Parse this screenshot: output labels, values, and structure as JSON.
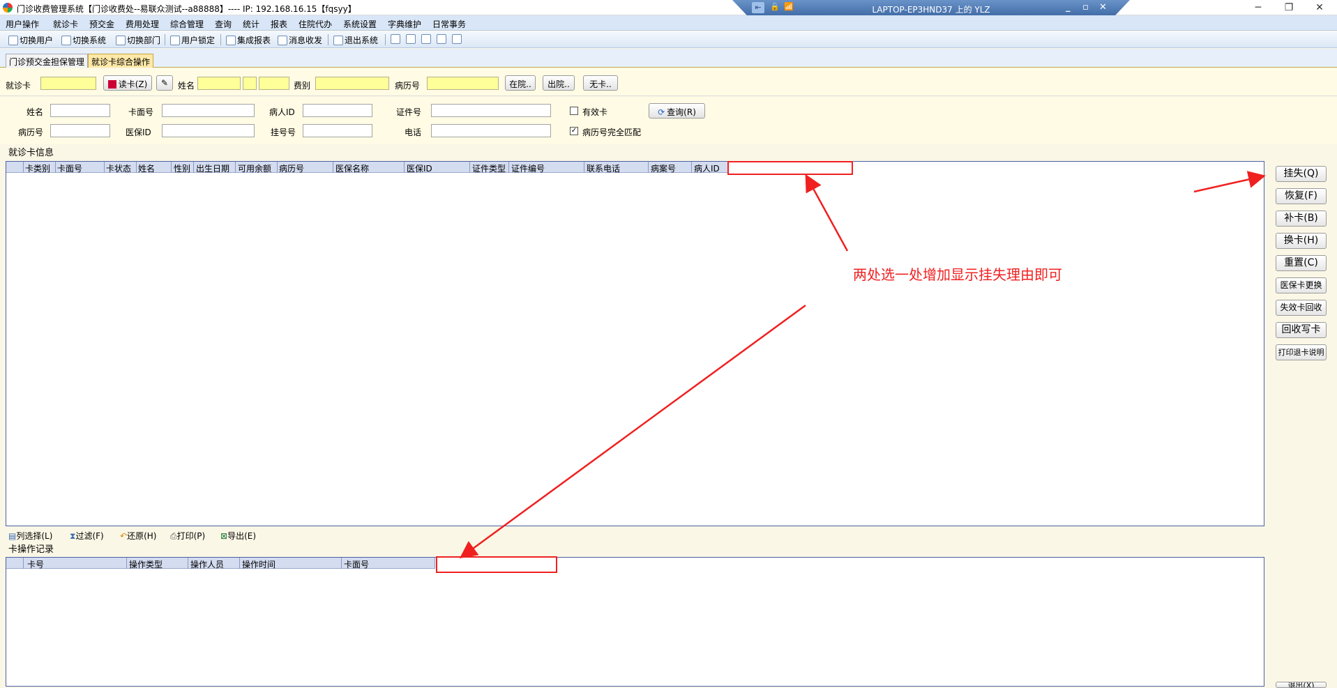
{
  "window": {
    "title": "门诊收费管理系统【门诊收费处--易联众测试--a88888】---- IP:  192.168.16.15【fqsyy】",
    "minimize": "─",
    "maximize": "❐",
    "close": "✕"
  },
  "rdp": {
    "title": "LAPTOP-EP3HND37 上的 YLZ",
    "pin": "⇤",
    "lock": "🔒",
    "signal": "📶",
    "min": "_",
    "restore": "▫",
    "close": "✕"
  },
  "menu": [
    "用户操作",
    "就诊卡",
    "预交金",
    "费用处理",
    "综合管理",
    "查询",
    "统计",
    "报表",
    "住院代办",
    "系统设置",
    "字典维护",
    "日常事务"
  ],
  "toolbar": [
    "切换用户",
    "切换系统",
    "切换部门",
    "用户锁定",
    "集成报表",
    "消息收发",
    "退出系统"
  ],
  "tabs": [
    "门诊预交金担保管理",
    "就诊卡综合操作"
  ],
  "top_form": {
    "card_label": "就诊卡",
    "read_card_btn": "读卡(Z)",
    "name_label": "姓名",
    "fee_type_label": "费别",
    "record_no_label": "病历号",
    "in_hospital_btn": "在院..",
    "discharge_btn": "出院..",
    "no_card_btn": "无卡.."
  },
  "search_form": {
    "name": "姓名",
    "card_face_no": "卡面号",
    "patient_id": "病人ID",
    "cert_no": "证件号",
    "valid_card": "有效卡",
    "query_btn": "查询(R)",
    "record_no": "病历号",
    "insurance_id": "医保ID",
    "reg_no": "挂号号",
    "phone": "电话",
    "exact_match": "病历号完全匹配",
    "valid_card_checked": false,
    "exact_match_checked": true
  },
  "card_info": {
    "title": "就诊卡信息",
    "columns": [
      "卡类别",
      "卡面号",
      "卡状态",
      "姓名",
      "性别",
      "出生日期",
      "可用余额",
      "病历号",
      "医保名称",
      "医保ID",
      "证件类型",
      "证件编号",
      "联系电话",
      "病案号",
      "病人ID"
    ]
  },
  "grid_tools": [
    "列选择(L)",
    "过滤(F)",
    "还原(H)",
    "打印(P)",
    "导出(E)"
  ],
  "op_records": {
    "title": "卡操作记录",
    "columns": [
      "卡号",
      "操作类型",
      "操作人员",
      "操作时间",
      "卡面号"
    ]
  },
  "side_buttons": [
    "挂失(Q)",
    "恢复(F)",
    "补卡(B)",
    "换卡(H)",
    "重置(C)",
    "医保卡更换",
    "失效卡回收",
    "回收写卡",
    "打印退卡说明"
  ],
  "exit_btn": "退出(X)",
  "annotation": "两处选一处增加显示挂失理由即可",
  "colors": {
    "accent_red": "#f02020",
    "field_yellow": "#ffff99",
    "grid_border": "#4a5fa6"
  }
}
